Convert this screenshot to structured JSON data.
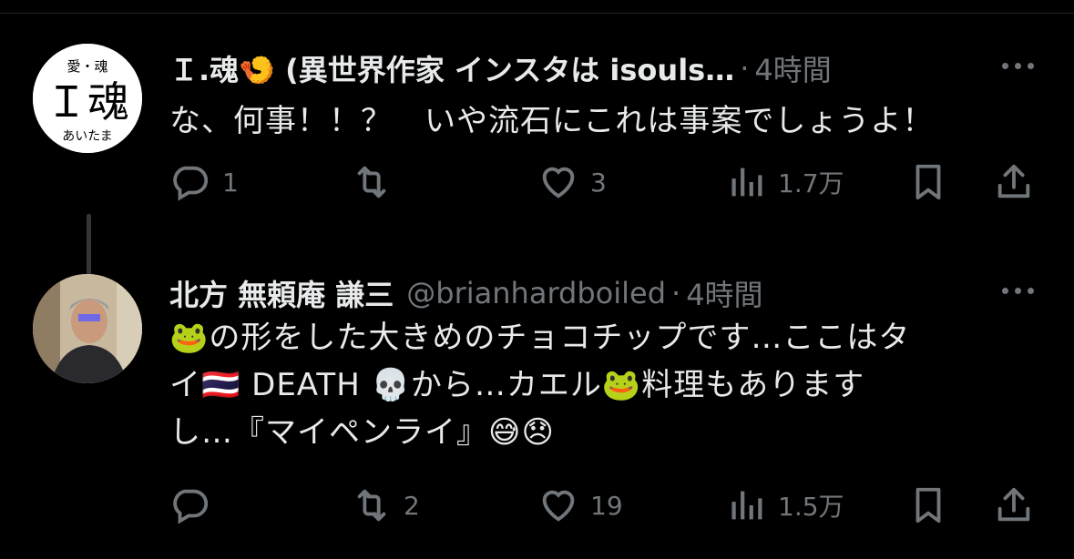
{
  "tweets": [
    {
      "display_name": "Ｉ.魂🍤 (異世界作家 インスタは isouls…",
      "handle": "",
      "separator": "·",
      "time": "4時間",
      "avatar_text": {
        "top": "愛・魂",
        "main": "Ｉ魂",
        "bottom": "あいたま"
      },
      "text_lines": [
        "な、何事！！？　いや流石にこれは事案でしょうよ！"
      ],
      "stats": {
        "replies": "1",
        "retweets": "",
        "likes": "3",
        "views": "1.7万"
      }
    },
    {
      "display_name": "北方 無頼庵 謙三",
      "handle": "@brianhardboiled",
      "separator": "·",
      "time": "4時間",
      "text_lines": [
        "🐸の形をした大きめのチョコチップです…ここはタ",
        "イ🇹🇭 DEATH 💀から…カエル🐸料理もあります",
        "し…『マイペンライ』😅😞"
      ],
      "stats": {
        "replies": "",
        "retweets": "2",
        "likes": "19",
        "views": "1.5万"
      }
    }
  ],
  "icons": [
    "reply-icon",
    "retweet-icon",
    "like-icon",
    "views-icon",
    "bookmark-icon",
    "share-icon",
    "more-icon"
  ],
  "colors": {
    "background": "#000000",
    "text": "#e7e9ea",
    "muted": "#71767b",
    "divider": "#333639"
  }
}
